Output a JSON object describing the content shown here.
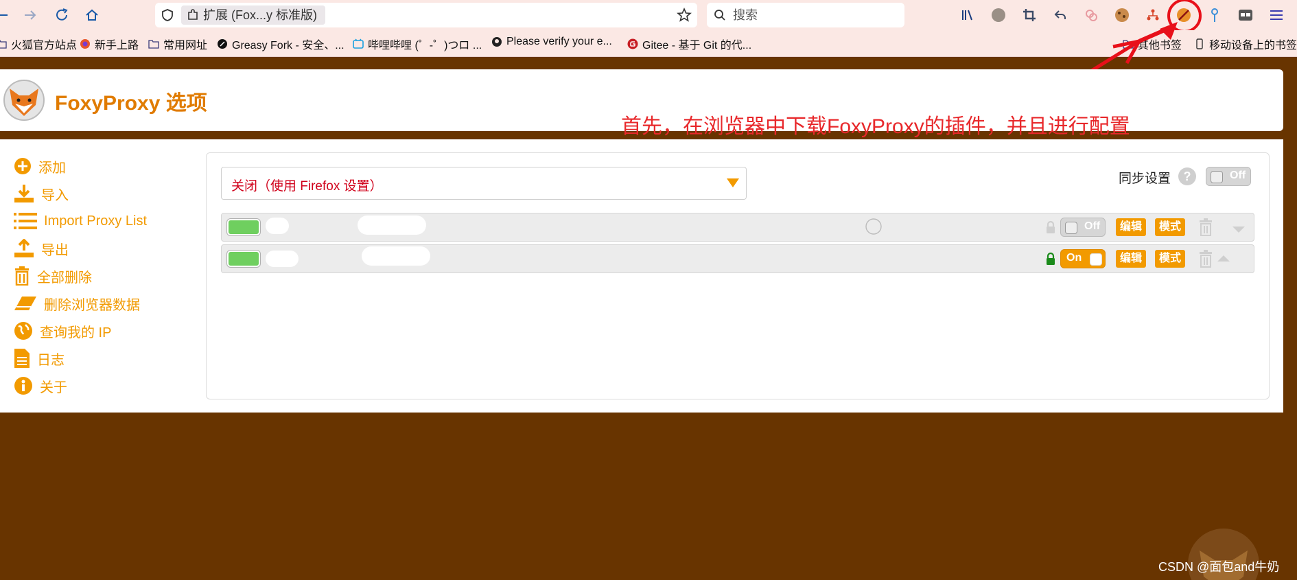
{
  "browser": {
    "tab_title": "扩展 (Fox...y 标准版)",
    "search_placeholder": "搜索",
    "bookmarks": [
      "火狐官方站点",
      "新手上路",
      "常用网址",
      "Greasy Fork - 安全、...",
      "哔哩哔哩 (゜-゜)つロ ...",
      "Please verify your e...",
      "Gitee - 基于 Git 的代...",
      "其他书签",
      "移动设备上的书签"
    ]
  },
  "header": {
    "title": "FoxyProxy 选项"
  },
  "sidebar": {
    "items": [
      {
        "label": "添加",
        "icon": "plus-circle-icon"
      },
      {
        "label": "导入",
        "icon": "download-icon"
      },
      {
        "label": "Import Proxy List",
        "icon": "list-icon"
      },
      {
        "label": "导出",
        "icon": "upload-icon"
      },
      {
        "label": "全部删除",
        "icon": "trash-icon"
      },
      {
        "label": "删除浏览器数据",
        "icon": "eraser-icon"
      },
      {
        "label": "查询我的 IP",
        "icon": "globe-icon"
      },
      {
        "label": "日志",
        "icon": "document-icon"
      },
      {
        "label": "关于",
        "icon": "info-icon"
      }
    ]
  },
  "mode_select": {
    "value": "关闭（使用 Firefox 设置）"
  },
  "sync": {
    "label": "同步设置",
    "help": "?",
    "toggle": "Off"
  },
  "proxies": [
    {
      "toggle": "Off",
      "edit": "编辑",
      "pattern": "模式",
      "locked": false
    },
    {
      "toggle": "On",
      "edit": "编辑",
      "pattern": "模式",
      "locked": true
    }
  ],
  "annotation": {
    "text": "首先，在浏览器中下载FoxyProxy的插件，并且进行配置"
  },
  "watermark": {
    "text": "CSDN @面包and牛奶"
  },
  "colors": {
    "accent": "#f29a00",
    "brand_bg": "#683400",
    "annotation": "#e8282b",
    "chip": "#6fcf5f"
  }
}
